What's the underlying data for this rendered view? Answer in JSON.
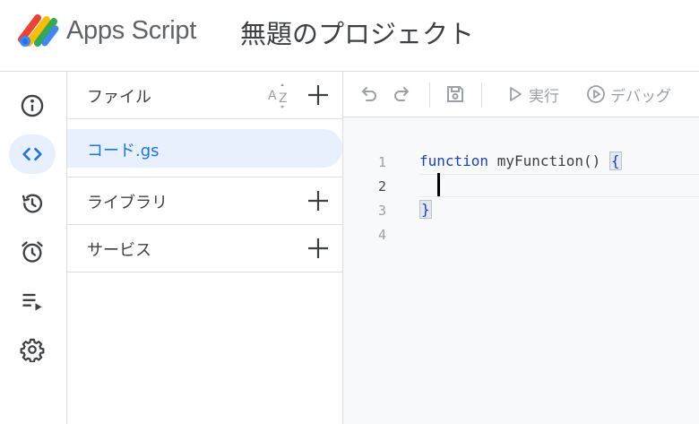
{
  "header": {
    "app_name": "Apps Script",
    "project_title": "無題のプロジェクト",
    "logo_icon": "apps-script-logo"
  },
  "rail": {
    "items": [
      {
        "name": "overview",
        "icon": "info-icon",
        "active": false
      },
      {
        "name": "editor",
        "icon": "code-icon",
        "active": true
      },
      {
        "name": "executions",
        "icon": "history-icon",
        "active": false
      },
      {
        "name": "triggers",
        "icon": "alarm-icon",
        "active": false
      },
      {
        "name": "executions-list",
        "icon": "playlist-play-icon",
        "active": false
      },
      {
        "name": "settings",
        "icon": "gear-icon",
        "active": false
      }
    ]
  },
  "files_panel": {
    "files_header": "ファイル",
    "files": [
      "コード.gs"
    ],
    "libraries_label": "ライブラリ",
    "services_label": "サービス"
  },
  "toolbar": {
    "run_label": "実行",
    "debug_label": "デバッグ"
  },
  "editor": {
    "line_numbers": [
      "1",
      "2",
      "3",
      "4"
    ],
    "current_line": "2",
    "lines": {
      "line1_keyword": "function",
      "line1_name": " myFunction() ",
      "line1_brace": "{",
      "line3_brace": "}"
    }
  },
  "colors": {
    "accent": "#1a73e8",
    "active_bg": "#e8f0fe",
    "border": "#dadce0",
    "editor_bg": "#f8f9fa",
    "keyword": "#1a3fb8"
  }
}
